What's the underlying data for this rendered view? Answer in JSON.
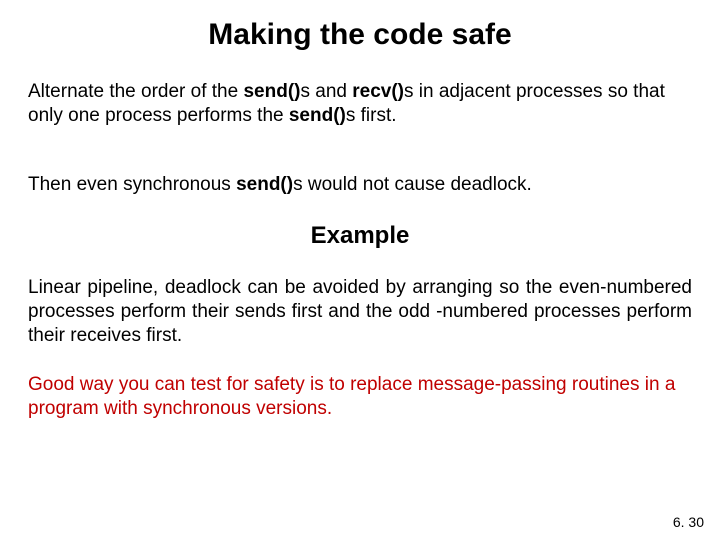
{
  "title": "Making the code safe",
  "p1": {
    "t1": "Alternate the order of the ",
    "b1": "send()",
    "t2": "s and ",
    "b2": "recv()",
    "t3": "s in adjacent processes so that only one process performs the ",
    "b3": "send()",
    "t4": "s first."
  },
  "p2": {
    "t1": "Then even synchronous ",
    "b1": "send()",
    "t2": "s would not cause deadlock."
  },
  "subhead": "Example",
  "p3": "Linear pipeline, deadlock can be avoided by arranging so the even-numbered processes perform their sends first and the odd -numbered processes perform their receives first.",
  "p4": "Good way you can test for safety is to replace message-passing routines in a program with synchronous versions.",
  "footer": "6. 30"
}
